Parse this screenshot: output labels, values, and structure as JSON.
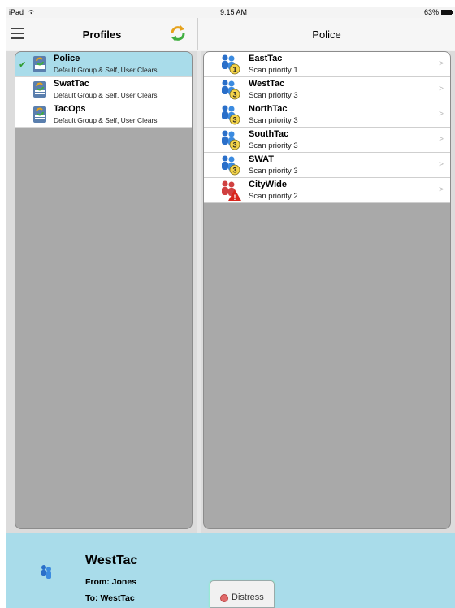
{
  "statusbar": {
    "device": "iPad",
    "time": "9:15 AM",
    "battery": "63%"
  },
  "nav": {
    "left_title": "Profiles",
    "right_title": "Police"
  },
  "profiles": [
    {
      "name": "Police",
      "subtitle": "Default Group & Self, User Clears",
      "selected": true
    },
    {
      "name": "SwatTac",
      "subtitle": "Default Group & Self, User Clears",
      "selected": false
    },
    {
      "name": "TacOps",
      "subtitle": "Default Group & Self, User Clears",
      "selected": false
    }
  ],
  "groups": [
    {
      "name": "EastTac",
      "subtitle": "Scan priority 1",
      "priority": "1"
    },
    {
      "name": "WestTac",
      "subtitle": "Scan priority 3",
      "priority": "3"
    },
    {
      "name": "NorthTac",
      "subtitle": "Scan priority 3",
      "priority": "3"
    },
    {
      "name": "SouthTac",
      "subtitle": "Scan priority 3",
      "priority": "3"
    },
    {
      "name": "SWAT",
      "subtitle": "Scan priority 3",
      "priority": "3"
    },
    {
      "name": "CityWide",
      "subtitle": "Scan priority 2",
      "priority": "2"
    }
  ],
  "current_call": {
    "title": "WestTac",
    "from": "From: Jones",
    "to": "To: WestTac"
  },
  "distress_label": "Distress",
  "colors": {
    "selected_row": "#a9dcea",
    "bottom_bar": "#a9dcea",
    "panel_bg": "#a9a9a9",
    "check": "#2e9b2e"
  }
}
